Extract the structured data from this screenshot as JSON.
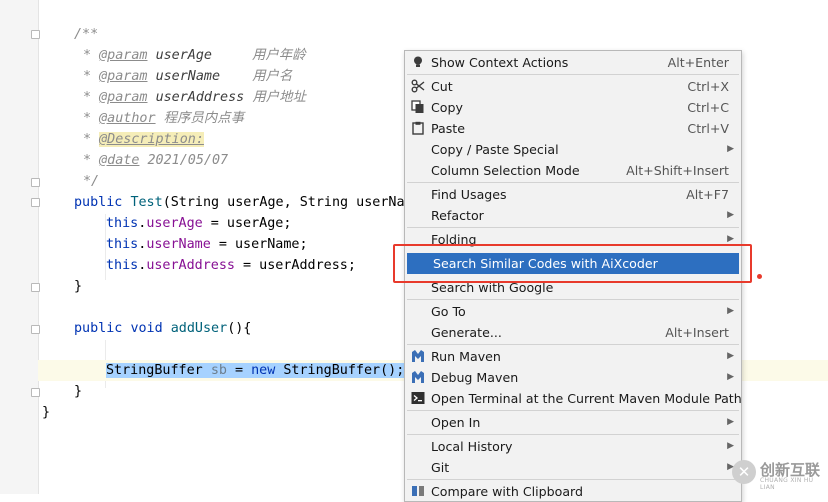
{
  "code": {
    "doc_open": "/**",
    "doc_star": "*",
    "doc_close": "*/",
    "param_tag": "@param",
    "author_tag": "@author",
    "description_tag": "@Description:",
    "date_tag": "@date",
    "param1_name": "userAge",
    "param1_desc": "用户年龄",
    "param2_name": "userName",
    "param2_desc": "用户名",
    "param3_name": "userAddress",
    "param3_desc": "用户地址",
    "author_value": "程序员内点事",
    "date_value": "2021/05/07",
    "kw_public": "public",
    "ctor_name": "Test",
    "ctor_params": "(String userAge, String userNar",
    "kw_this": "this",
    "fld_userAge": "userAge",
    "fld_userName": "userName",
    "fld_userAddress": "userAddress",
    "assign_userAge": " = userAge;",
    "assign_userName": " = userName;",
    "assign_userAddress": " = userAddress;",
    "dot": ".",
    "close_brace": "}",
    "kw_void": "void",
    "method_name": "addUser",
    "method_rest": "(){",
    "sel_type": "StringBuffer ",
    "sel_var": "sb",
    "sel_eq": " = ",
    "kw_new": "new",
    "sel_ctor": " StringBuffer();",
    "space": " "
  },
  "context_menu": {
    "items": [
      {
        "label": "Show Context Actions",
        "shortcut": "Alt+Enter",
        "icon": "bulb-icon"
      },
      {
        "label": "Cut",
        "shortcut": "Ctrl+X",
        "icon": "scissors-icon"
      },
      {
        "label": "Copy",
        "shortcut": "Ctrl+C",
        "icon": "copy-icon"
      },
      {
        "label": "Paste",
        "shortcut": "Ctrl+V",
        "icon": "paste-icon"
      },
      {
        "label": "Copy / Paste Special",
        "submenu": true
      },
      {
        "label": "Column Selection Mode",
        "shortcut": "Alt+Shift+Insert"
      },
      {
        "label": "Find Usages",
        "shortcut": "Alt+F7"
      },
      {
        "label": "Refactor",
        "submenu": true
      },
      {
        "label": "Folding",
        "submenu": true
      },
      {
        "label": "Search Similar Codes with AiXcoder",
        "active": true
      },
      {
        "label": "Search with Google"
      },
      {
        "label": "Go To",
        "submenu": true
      },
      {
        "label": "Generate...",
        "shortcut": "Alt+Insert"
      },
      {
        "label": "Run Maven",
        "submenu": true,
        "icon": "maven-icon"
      },
      {
        "label": "Debug Maven",
        "submenu": true,
        "icon": "maven-icon"
      },
      {
        "label": "Open Terminal at the Current Maven Module Path",
        "icon": "terminal-icon"
      },
      {
        "label": "Open In",
        "submenu": true
      },
      {
        "label": "Local History",
        "submenu": true
      },
      {
        "label": "Git",
        "submenu": true
      },
      {
        "label": "Compare with Clipboard",
        "icon": "compare-icon"
      }
    ],
    "submenu_arrow": "▶"
  },
  "watermark": {
    "logo_glyph": "✕",
    "brand": "创新互联",
    "sub": "CHUANG XIN HU LIAN"
  },
  "colors": {
    "accent_selected": "#2d6fc0",
    "selection": "#a6d2ff",
    "annotation_box": "#e83a2c",
    "keyword": "#0033b3",
    "field": "#871094"
  }
}
